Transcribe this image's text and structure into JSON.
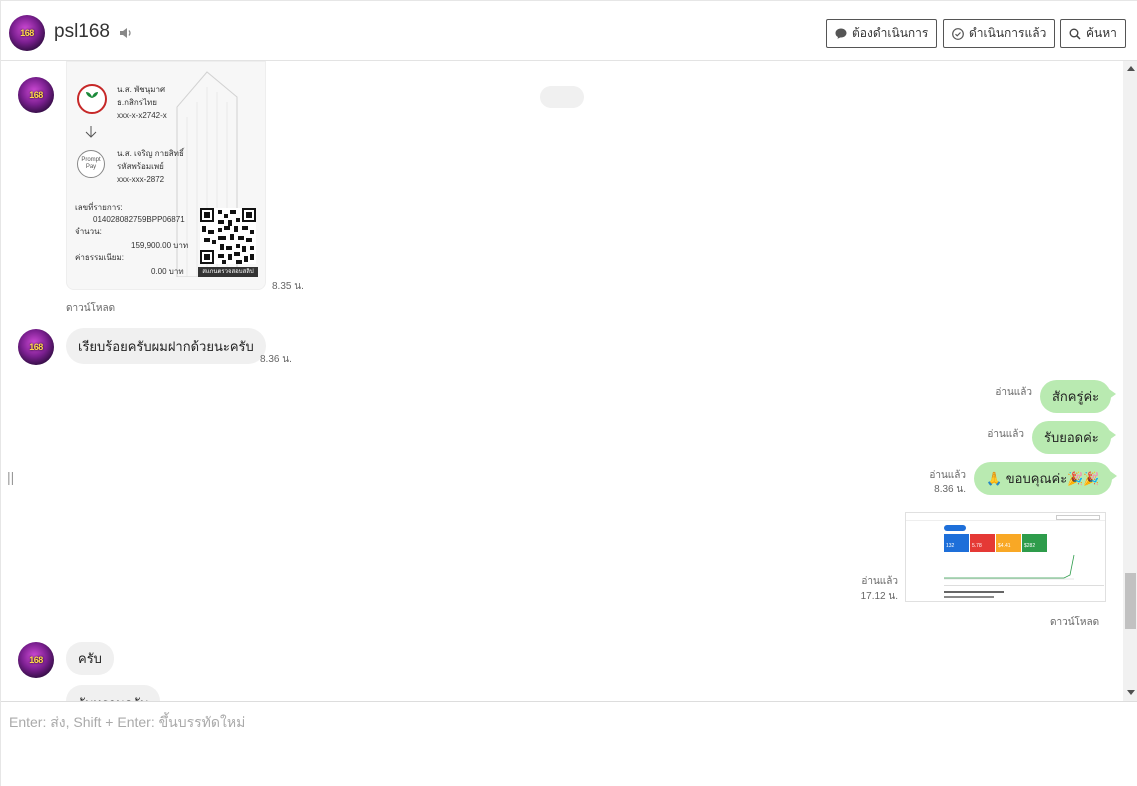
{
  "header": {
    "avatar_text": "168",
    "title": "psl168",
    "buttons": {
      "pending": "ต้องดำเนินการ",
      "done": "ดำเนินการแล้ว",
      "search": "ค้นหา"
    }
  },
  "messages": {
    "slip": {
      "payer_name": "น.ส. พัชนุมาศ",
      "payer_bank": "ธ.กสิกรไทย",
      "payer_account": "xxx-x-x2742-x",
      "payee_name": "น.ส. เจริญ กายสิทธิ์",
      "payee_bank": "รหัสพร้อมเพย์",
      "payee_account": "xxx-xxx-2872",
      "ref_label": "เลขที่รายการ:",
      "ref_value": "014028082759BPP06871",
      "amount_label": "จำนวน:",
      "amount_value": "159,900.00 บาท",
      "fee_label": "ค่าธรรมเนียม:",
      "fee_value": "0.00 บาท",
      "qr_caption": "สแกนตรวจสอบสลิป",
      "promptpay_logo": "Prompt Pay",
      "time": "8.35 น.",
      "download": "ดาวน์โหลด"
    },
    "in_1": {
      "text": "เรียบร้อยครับผมฝากด้วยนะครับ",
      "time": "8.36 น."
    },
    "out_1": {
      "text": "สักครู่ค่ะ",
      "status": "อ่านแล้ว"
    },
    "out_2": {
      "text": "รับยอดค่ะ",
      "status": "อ่านแล้ว"
    },
    "out_3": {
      "text": "🙏 ขอบคุณค่ะ🎉🎉",
      "status": "อ่านแล้ว",
      "time": "8.36 น."
    },
    "out_4": {
      "status": "อ่านแล้ว",
      "time": "17.12 น.",
      "download": "ดาวน์โหลด",
      "card_values": [
        "132",
        "5.78",
        "$4.41",
        "$282"
      ]
    },
    "in_2": {
      "text": "ครับ"
    },
    "in_3": {
      "text": "รับทราบครับ"
    }
  },
  "composer": {
    "placeholder": "Enter: ส่ง, Shift + Enter: ขึ้นบรรทัดใหม่"
  },
  "colors": {
    "outgoing_bubble": "#b9eab1",
    "incoming_bubble": "#f0f0f0",
    "dash_blue": "#1e6fd9",
    "dash_red": "#e53935",
    "dash_yellow": "#f9a825",
    "dash_green": "#2e9c4b"
  }
}
